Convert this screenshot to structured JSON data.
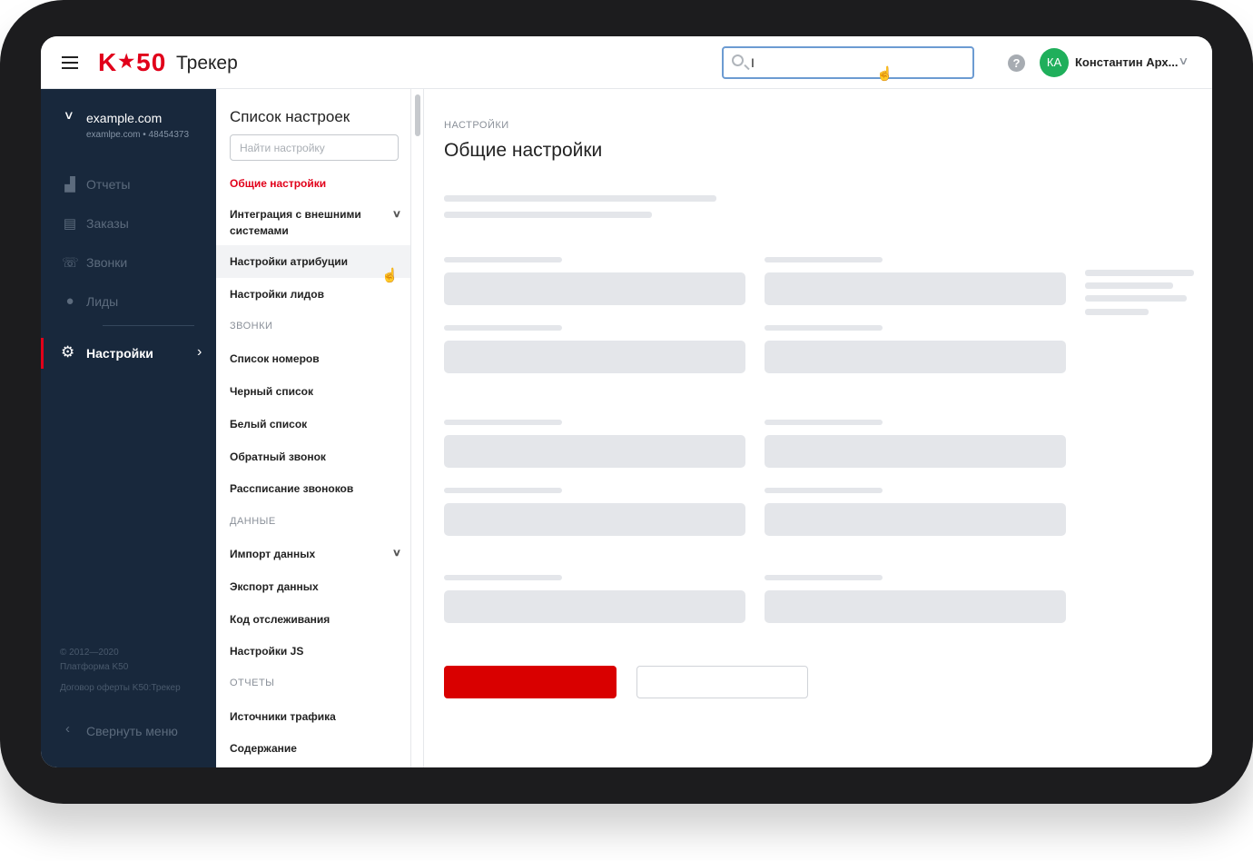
{
  "header": {
    "logo": "K★50",
    "logo_main": "K",
    "logo_star": "★",
    "logo_num": "50",
    "product": "Трекер",
    "search_value": "I",
    "help_icon": "?",
    "avatar_initials": "КА",
    "user_name": "Константин Арх..."
  },
  "sidebar": {
    "site_name": "example.com",
    "site_sub": "examlpe.com • 48454373",
    "items": [
      {
        "label": "Отчеты",
        "icon": "chart-icon"
      },
      {
        "label": "Заказы",
        "icon": "orders-icon"
      },
      {
        "label": "Звонки",
        "icon": "calls-icon"
      },
      {
        "label": "Лиды",
        "icon": "user-icon"
      }
    ],
    "active_item": {
      "label": "Настройки",
      "icon": "gear-icon"
    },
    "footer": {
      "copyright": "© 2012—2020",
      "platform": "Платформа K50",
      "offer": "Договор оферты K50:Трекер"
    },
    "collapse_label": "Свернуть меню"
  },
  "settings": {
    "title": "Список настроек",
    "search_placeholder": "Найти настройку",
    "items": [
      {
        "label": "Общие настройки"
      },
      {
        "label": "Интеграция с внешними системами"
      },
      {
        "label": "Настройки атрибуции"
      },
      {
        "label": "Настройки лидов"
      },
      {
        "section": "ЗВОНКИ"
      },
      {
        "label": "Список номеров"
      },
      {
        "label": "Черный список"
      },
      {
        "label": "Белый список"
      },
      {
        "label": "Обратный звонок"
      },
      {
        "label": "Рассписание звоноков"
      },
      {
        "section": "ДАННЫЕ"
      },
      {
        "label": "Импорт данных"
      },
      {
        "label": "Экспорт данных"
      },
      {
        "label": "Код отслеживания"
      },
      {
        "label": "Настройки JS"
      },
      {
        "section": "ОТЧЕТЫ"
      },
      {
        "label": "Источники трафика"
      },
      {
        "label": "Содержание"
      }
    ]
  },
  "main": {
    "breadcrumb": "НАСТРОЙКИ",
    "title": "Общие настройки"
  },
  "colors": {
    "brand_red": "#e1001a",
    "sidebar_bg": "#18283c",
    "avatar_green": "#1faf5b",
    "primary_button": "#d90000",
    "skeleton": "#e4e6ea"
  }
}
